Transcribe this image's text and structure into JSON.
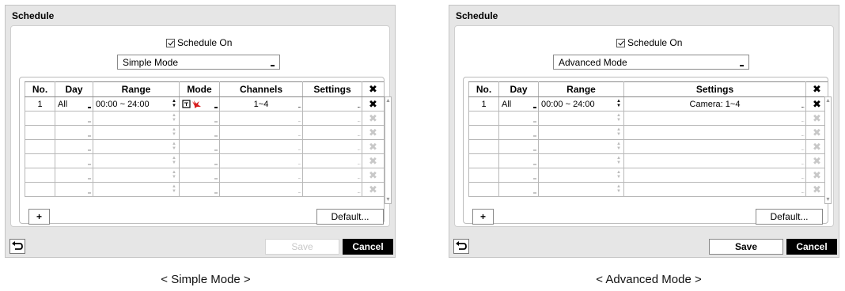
{
  "simple": {
    "title": "Schedule",
    "schedule_on_label": "Schedule On",
    "mode_select": "Simple Mode",
    "headers": [
      "No.",
      "Day",
      "Range",
      "Mode",
      "Channels",
      "Settings"
    ],
    "row1": {
      "no": "1",
      "day": "All",
      "range": "00:00 ~ 24:00",
      "channels": "1~4",
      "settings": ""
    },
    "add_button": "+",
    "default_button": "Default...",
    "save_button": "Save",
    "cancel_button": "Cancel",
    "caption": "< Simple Mode >"
  },
  "advanced": {
    "title": "Schedule",
    "schedule_on_label": "Schedule On",
    "mode_select": "Advanced Mode",
    "headers": [
      "No.",
      "Day",
      "Range",
      "Settings"
    ],
    "row1": {
      "no": "1",
      "day": "All",
      "range": "00:00 ~ 24:00",
      "settings": "Camera: 1~4"
    },
    "add_button": "+",
    "default_button": "Default...",
    "save_button": "Save",
    "cancel_button": "Cancel",
    "caption": "< Advanced Mode >"
  },
  "icons": {
    "delete": "close-x-icon",
    "back": "back-arrow-icon",
    "record_mode": "record-event-icon"
  },
  "colors": {
    "cancel_bg": "#000000",
    "disabled_text": "#c8c8c8"
  }
}
